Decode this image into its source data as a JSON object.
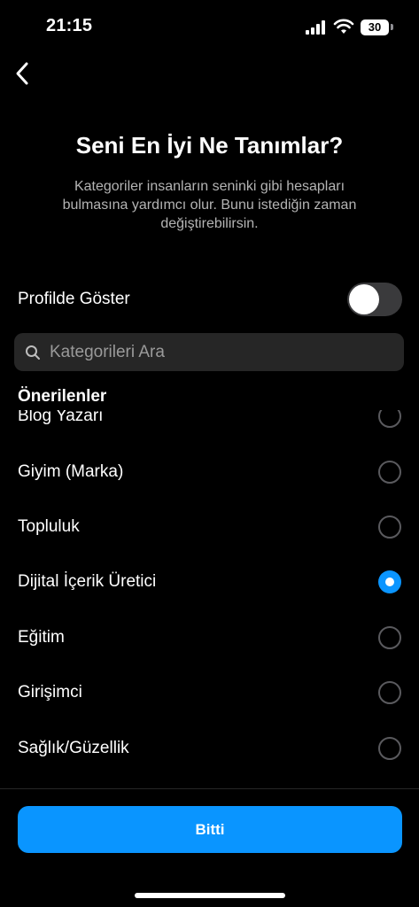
{
  "status_bar": {
    "time": "21:15",
    "battery": "30"
  },
  "header": {
    "title": "Seni En İyi Ne Tanımlar?",
    "subtitle": "Kategoriler insanların seninki gibi hesapları bulmasına yardımcı olur. Bunu istediğin zaman değiştirebilirsin."
  },
  "profile_toggle": {
    "label": "Profilde Göster",
    "enabled": false
  },
  "search": {
    "placeholder": "Kategorileri Ara",
    "value": ""
  },
  "section": {
    "title": "Önerilenler"
  },
  "categories": [
    {
      "label": "Blog Yazarı",
      "selected": false
    },
    {
      "label": "Giyim (Marka)",
      "selected": false
    },
    {
      "label": "Topluluk",
      "selected": false
    },
    {
      "label": "Dijital İçerik Üretici",
      "selected": true
    },
    {
      "label": "Eğitim",
      "selected": false
    },
    {
      "label": "Girişimci",
      "selected": false
    },
    {
      "label": "Sağlık/Güzellik",
      "selected": false
    }
  ],
  "footer": {
    "done_label": "Bitti"
  },
  "colors": {
    "accent": "#0a95ff",
    "background": "#000000"
  }
}
